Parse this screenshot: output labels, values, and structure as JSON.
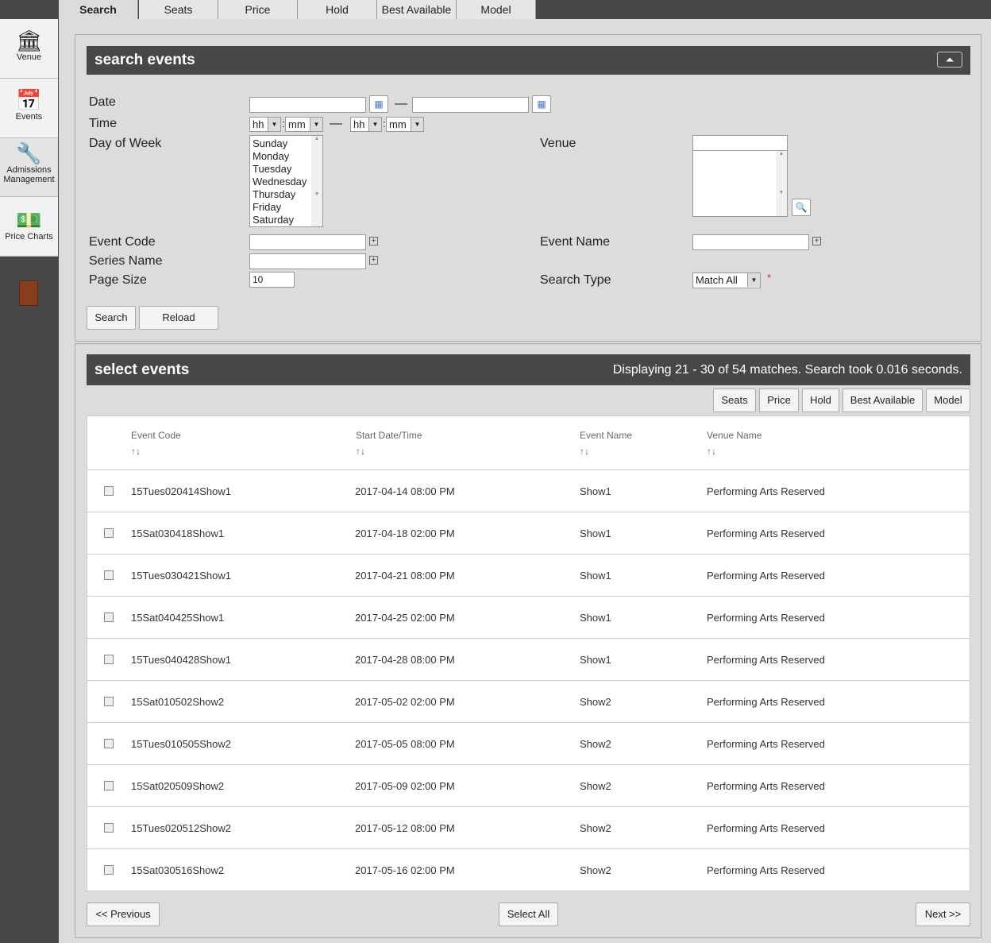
{
  "sidebar": {
    "items": [
      {
        "label": "Venue",
        "icon": "venue-icon"
      },
      {
        "label": "Events",
        "icon": "calendar-icon"
      },
      {
        "label": "Admissions Management",
        "icon": "admissions-icon"
      },
      {
        "label": "Price Charts",
        "icon": "price-chart-icon"
      }
    ],
    "exit_icon": "exit-door-icon"
  },
  "tabs": [
    {
      "label": "Search",
      "active": true
    },
    {
      "label": "Seats"
    },
    {
      "label": "Price"
    },
    {
      "label": "Hold"
    },
    {
      "label": "Best Available"
    },
    {
      "label": "Model"
    }
  ],
  "search": {
    "title": "search events",
    "date_label": "Date",
    "time_label": "Time",
    "day_label": "Day of Week",
    "days": [
      "Sunday",
      "Monday",
      "Tuesday",
      "Wednesday",
      "Thursday",
      "Friday",
      "Saturday"
    ],
    "hh": "hh",
    "mm": "mm",
    "dash": "—",
    "colon": ":",
    "venue_label": "Venue",
    "event_code_label": "Event Code",
    "event_name_label": "Event Name",
    "series_label": "Series Name",
    "page_size_label": "Page Size",
    "page_size_value": "10",
    "search_type_label": "Search Type",
    "search_type_value": "Match All",
    "required": "*",
    "search_button": "Search",
    "reload_button": "Reload"
  },
  "results": {
    "title": "select events",
    "status": "Displaying 21 - 30 of 54 matches. Search took 0.016 seconds.",
    "actions": [
      "Seats",
      "Price",
      "Hold",
      "Best Available",
      "Model"
    ],
    "columns": [
      "Event Code",
      "Start Date/Time",
      "Event Name",
      "Venue Name"
    ],
    "sort": "↑↓",
    "rows": [
      [
        "15Tues020414Show1",
        "2017-04-14 08:00 PM",
        "Show1",
        "Performing Arts Reserved"
      ],
      [
        "15Sat030418Show1",
        "2017-04-18 02:00 PM",
        "Show1",
        "Performing Arts Reserved"
      ],
      [
        "15Tues030421Show1",
        "2017-04-21 08:00 PM",
        "Show1",
        "Performing Arts Reserved"
      ],
      [
        "15Sat040425Show1",
        "2017-04-25 02:00 PM",
        "Show1",
        "Performing Arts Reserved"
      ],
      [
        "15Tues040428Show1",
        "2017-04-28 08:00 PM",
        "Show1",
        "Performing Arts Reserved"
      ],
      [
        "15Sat010502Show2",
        "2017-05-02 02:00 PM",
        "Show2",
        "Performing Arts Reserved"
      ],
      [
        "15Tues010505Show2",
        "2017-05-05 08:00 PM",
        "Show2",
        "Performing Arts Reserved"
      ],
      [
        "15Sat020509Show2",
        "2017-05-09 02:00 PM",
        "Show2",
        "Performing Arts Reserved"
      ],
      [
        "15Tues020512Show2",
        "2017-05-12 08:00 PM",
        "Show2",
        "Performing Arts Reserved"
      ],
      [
        "15Sat030516Show2",
        "2017-05-16 02:00 PM",
        "Show2",
        "Performing Arts Reserved"
      ]
    ],
    "prev": "<< Previous",
    "select_all": "Select All",
    "next": "Next >>"
  }
}
